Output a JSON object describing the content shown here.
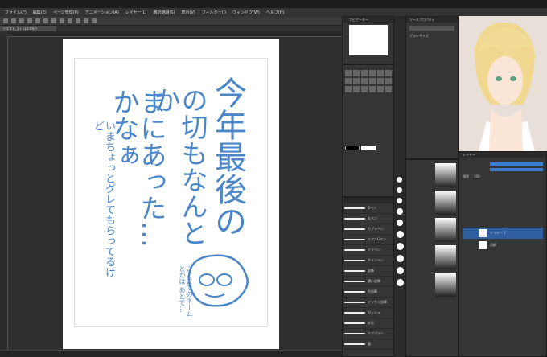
{
  "menu": [
    "ファイル(F)",
    "編集(E)",
    "ページ管理(P)",
    "アニメーション(A)",
    "レイヤー(L)",
    "選択範囲(S)",
    "表示(V)",
    "フィルター(I)",
    "ウィンドウ(W)",
    "ヘルプ(H)"
  ],
  "document": {
    "tab": "イラスト_1 ( 110.0% )",
    "text_col1": "今年最後の",
    "text_col2": "の切もなんとか",
    "text_col3": "まにあった…かなぁ",
    "text_col4": "いまちょっとグレてもらってるけど",
    "small_note": "ここまでのネームとかは あとで…"
  },
  "panels": {
    "navigator": "ナビゲーター",
    "tool_property": "ツールプロパティ",
    "brush_size": "ブラシサイズ",
    "layer": "レイヤー",
    "normal": "通常",
    "layer_color": "レイヤーカラー",
    "layer_name": "レイヤー 1",
    "paper": "用紙",
    "opacity": "100",
    "zoom": "110.0"
  },
  "brushes": [
    "Gペン",
    "丸ペン",
    "カブラペン",
    "リアルGペン",
    "ミリペン",
    "サインペン",
    "鉛筆",
    "濃い鉛筆",
    "色鉛筆",
    "デッサン鉛筆",
    "ガッシュ",
    "水彩",
    "エアブラシ",
    "墨"
  ],
  "colors": {
    "accent": "#4a90d9",
    "ink": "#4a86c8",
    "blue_bar": "#3a7fd0"
  }
}
